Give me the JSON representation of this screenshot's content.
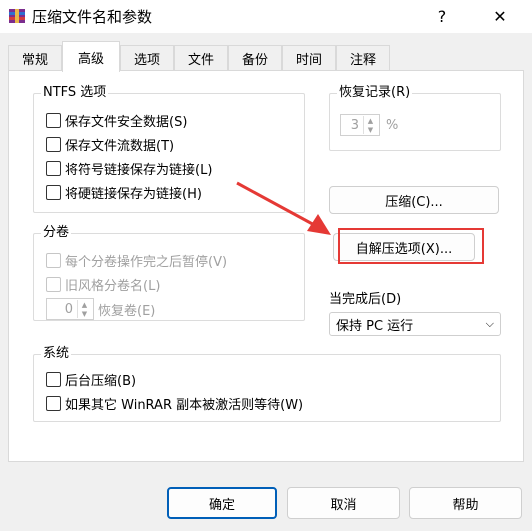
{
  "window": {
    "title": "压缩文件名和参数",
    "help_glyph": "?",
    "close_glyph": "✕"
  },
  "tabs": [
    "常规",
    "高级",
    "选项",
    "文件",
    "备份",
    "时间",
    "注释"
  ],
  "ntfs": {
    "title": "NTFS 选项",
    "options": [
      "保存文件安全数据(S)",
      "保存文件流数据(T)",
      "将符号链接保存为链接(L)",
      "将硬链接保存为链接(H)"
    ]
  },
  "recovery": {
    "title": "恢复记录(R)",
    "value": "3",
    "unit": "%"
  },
  "volumes": {
    "title": "分卷",
    "options": [
      "每个分卷操作完之后暂停(V)",
      "旧风格分卷名(L)"
    ],
    "spin_value": "0",
    "spin_label": "恢复卷(E)"
  },
  "buttons": {
    "compress": "压缩(C)...",
    "sfx": "自解压选项(X)...",
    "ok": "确定",
    "cancel": "取消",
    "help": "帮助"
  },
  "after": {
    "label": "当完成后(D)",
    "selected": "保持 PC 运行"
  },
  "system": {
    "title": "系统",
    "options": [
      "后台压缩(B)",
      "如果其它 WinRAR 副本被激活则等待(W)"
    ]
  },
  "colors": {
    "highlight": "#e53935",
    "primary_border": "#005fb8"
  }
}
